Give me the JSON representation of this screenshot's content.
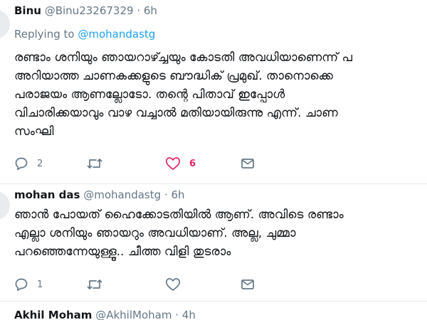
{
  "tweets": [
    {
      "name": "Binu",
      "handle": "@Binu23267329",
      "dot": "·",
      "time": "6h",
      "replying_prefix": "Replying to",
      "replying_to": "@mohandastg",
      "lines": [
        "രണ്ടാം ശനിയും ഞായറാഴ്ച്ചയും കോടതി അവധിയാണെന്ന് പ",
        "അറിയാത്ത ചാണകക്കളുടെ ബൗദ്ധിക് പ്രമുഖ്. താനൊക്കെ",
        "പരാജയം ആണല്ലോടോ. തന്റെ പിതാവ് ഇപ്പോൾ",
        "വിചാരിക്കയാവും വാഴ വച്ചാൽ മതിയായിരുന്നു എന്ന്. ചാണ",
        "സംഘി"
      ],
      "replies": "2",
      "retweets": "",
      "likes": "6",
      "liked": true
    },
    {
      "name": "mohan das",
      "handle": "@mohandastg",
      "dot": "·",
      "time": "6h",
      "lines": [
        "ഞാൻ പോയത് ഹൈക്കോടതിയിൽ ആണ്. അവിടെ രണ്ടാം",
        "എല്ലാ ശനിയും ഞായറും അവധിയാണ്. അല്ല, ചുമ്മാ",
        "പറഞ്ഞെന്നേയുള്ളൂ.. ചീത്ത വിളി തുടരാം"
      ],
      "replies": "1",
      "retweets": "",
      "likes": ""
    },
    {
      "name": "Akhil Moham",
      "handle": "@AkhilMoham",
      "dot": "·",
      "time": "4h"
    }
  ],
  "icons": {
    "reply": "reply-icon",
    "retweet": "retweet-icon",
    "like": "heart-icon",
    "message": "direct-message-icon"
  },
  "colors": {
    "name": "#14171a",
    "meta": "#657786",
    "link": "#1da1f2",
    "like": "#e0245e",
    "divider": "#e6ecf0"
  }
}
